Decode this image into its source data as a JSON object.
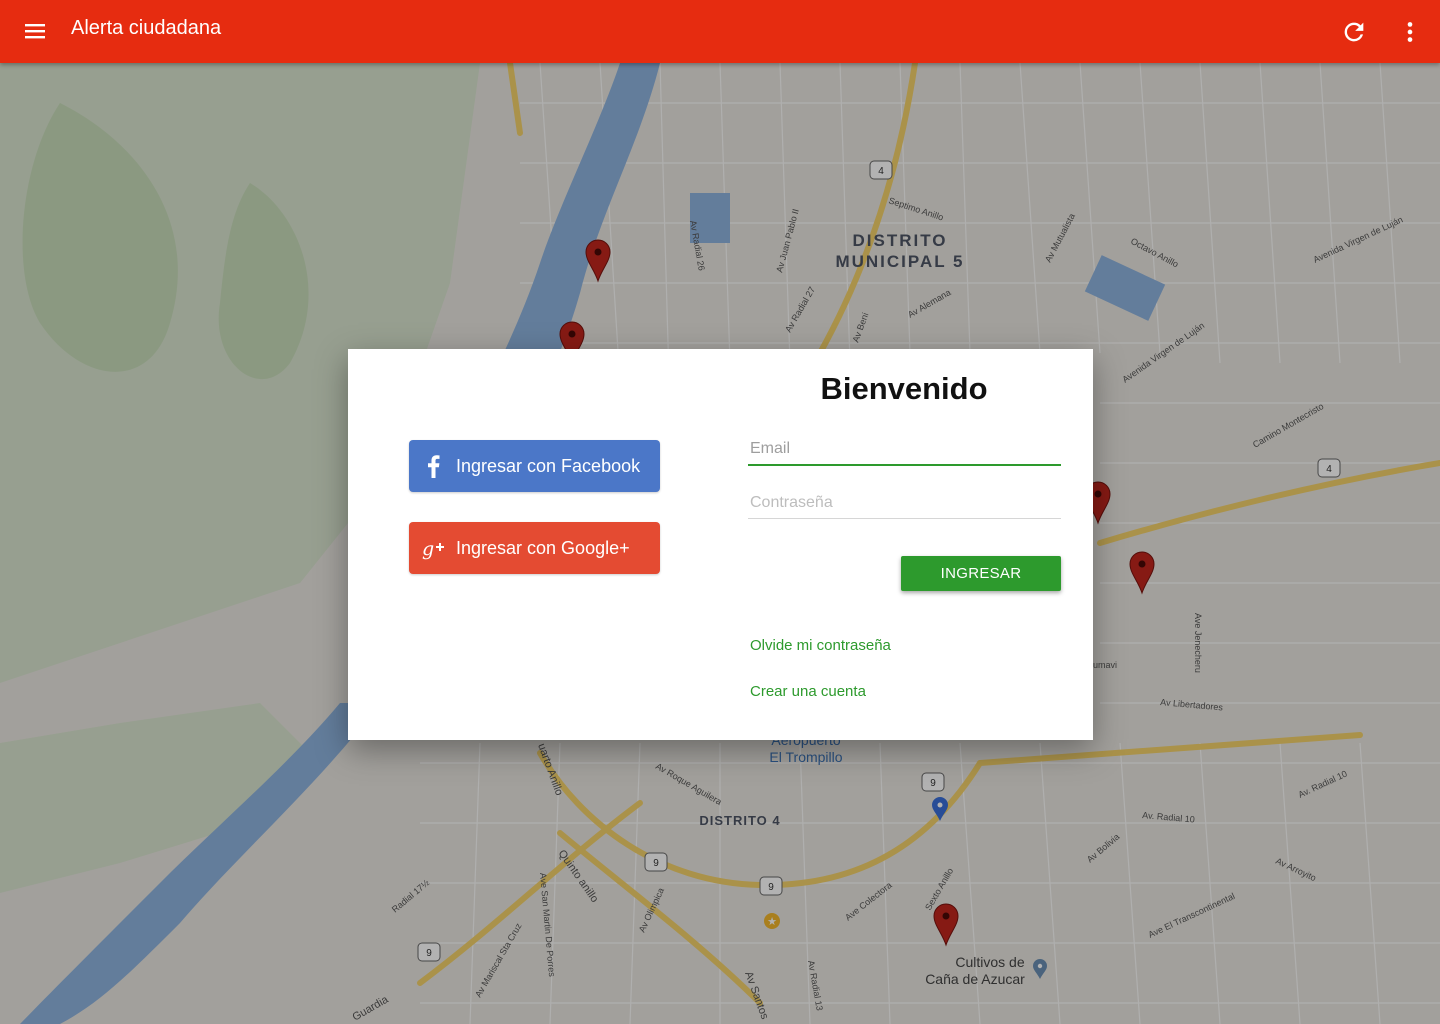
{
  "app": {
    "title": "Alerta ciudadana",
    "color": "#e62c10",
    "icons": [
      "menu-icon",
      "refresh-icon",
      "more-vert-icon"
    ]
  },
  "map": {
    "labels": [
      "DISTRITO",
      "MUNICIPAL 5",
      "DISTRITO 4",
      "Aeropuerto",
      "El Trompillo",
      "Cultivos de",
      "Caña de Azucar",
      "Septimo Anillo",
      "Octavo Anillo",
      "Av Radial 26",
      "Av Juan Pablo II",
      "Av Radial 27",
      "Av Alemana",
      "Av Beni",
      "Av Mutualista",
      "Avenida Virgen de Luján",
      "Camino Montecristo",
      "Ave Jenecheru",
      "Av Libertadores",
      "Av Roque Aguilera",
      "Quinto anillo",
      "Ave San Martin De Porres",
      "Av Mariscal Sta Cruz",
      "Av Santos",
      "Av Radial 13",
      "Ave Colectora",
      "Sexto Anillo",
      "Av Bolivia",
      "Av Arroyito",
      "Ave El Transcontinental",
      "Av. Radial 10",
      "Radial 17½",
      "Av Olimpica",
      "uarto Anillo",
      "Guardia",
      "umavi",
      "4",
      "9"
    ]
  },
  "login": {
    "heading": "Bienvenido",
    "facebook_label": "Ingresar con Facebook",
    "google_label": "Ingresar con Google+",
    "email_placeholder": "Email",
    "email_value": "",
    "password_placeholder": "Contraseña",
    "password_value": "",
    "submit_label": "INGRESAR",
    "forgot_label": "Olvide mi contraseña",
    "create_label": "Crear una cuenta",
    "colors": {
      "facebook": "#4b77c8",
      "google": "#e44b32",
      "accent": "#2d9a2d"
    }
  }
}
